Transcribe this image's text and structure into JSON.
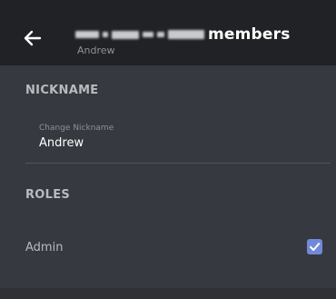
{
  "header": {
    "back_icon": "arrow-left-icon",
    "title": "members",
    "subtitle": "Andrew"
  },
  "nickname": {
    "heading": "NICKNAME",
    "field_label": "Change Nickname",
    "field_value": "Andrew"
  },
  "roles": {
    "heading": "ROLES",
    "items": [
      {
        "label": "Admin",
        "checked": true
      }
    ]
  },
  "colors": {
    "background": "#36393f",
    "header": "#202225",
    "accent": "#7289da"
  }
}
